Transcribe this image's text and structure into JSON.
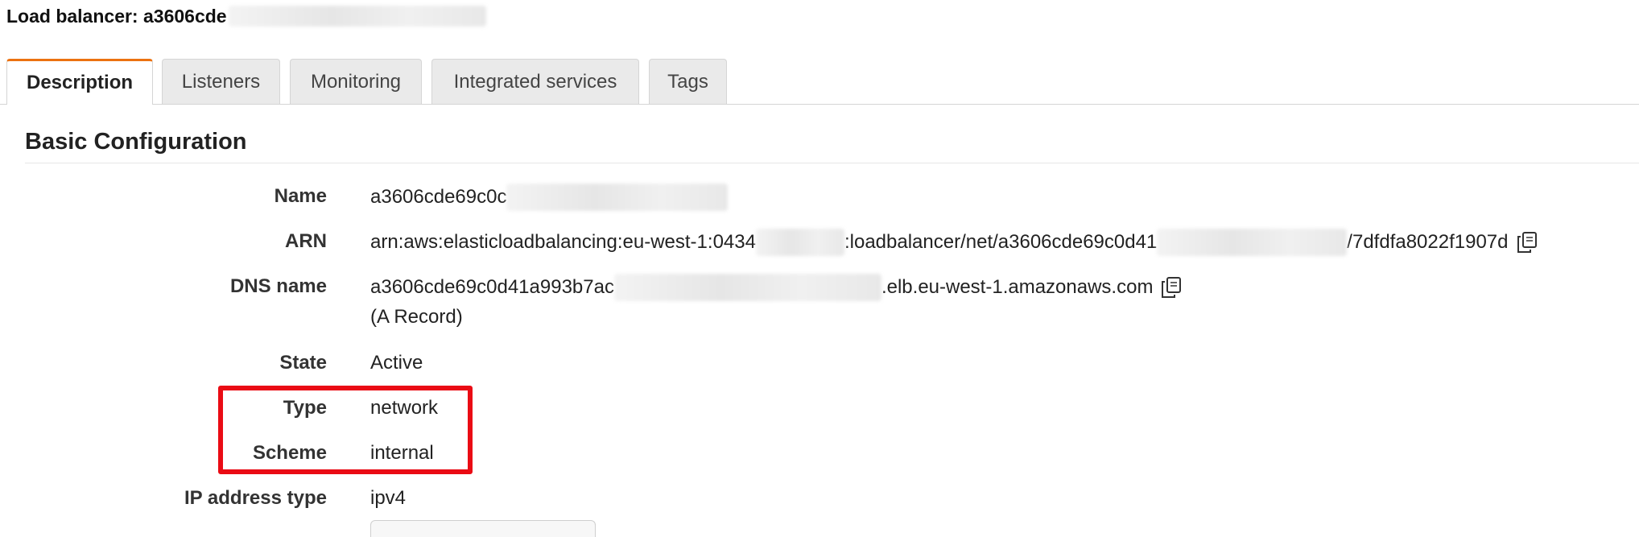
{
  "header": {
    "title_prefix": "Load balancer: a3606cde"
  },
  "tabs": [
    {
      "label": "Description",
      "active": true
    },
    {
      "label": "Listeners",
      "active": false
    },
    {
      "label": "Monitoring",
      "active": false
    },
    {
      "label": "Integrated services",
      "active": false
    },
    {
      "label": "Tags",
      "active": false
    }
  ],
  "section": {
    "title": "Basic Configuration"
  },
  "details": {
    "name": {
      "label": "Name",
      "value": "a3606cde69c0c"
    },
    "arn": {
      "label": "ARN",
      "value_part1": "arn:aws:elasticloadbalancing:eu-west-1:0434",
      "value_part2": ":loadbalancer/net/a3606cde69c0d41",
      "value_part3": "/7dfdfa8022f1907d"
    },
    "dns": {
      "label": "DNS name",
      "value_part1": "a3606cde69c0d41a993b7ac",
      "value_part2": ".elb.eu-west-1.amazonaws.com",
      "record": "(A Record)"
    },
    "state": {
      "label": "State",
      "value": "Active"
    },
    "type": {
      "label": "Type",
      "value": "network"
    },
    "scheme": {
      "label": "Scheme",
      "value": "internal"
    },
    "ip_address_type": {
      "label": "IP address type",
      "value": "ipv4"
    }
  },
  "colors": {
    "active_tab_accent": "#ec7211",
    "highlight": "#ea0b14"
  },
  "icons": {
    "copy": "copy-icon"
  }
}
